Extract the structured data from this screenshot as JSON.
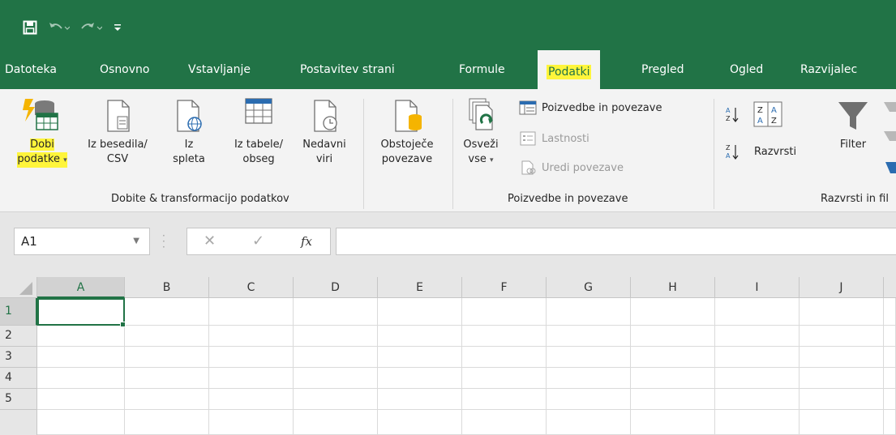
{
  "qat": {
    "save_icon": "save-icon",
    "undo_icon": "undo-icon",
    "redo_icon": "redo-icon",
    "customize_icon": "customize-qat-icon"
  },
  "tabs": [
    {
      "label": "Datoteka"
    },
    {
      "label": "Osnovno"
    },
    {
      "label": "Vstavljanje"
    },
    {
      "label": "Postavitev strani"
    },
    {
      "label": "Formule"
    },
    {
      "label": "Podatki",
      "active": true
    },
    {
      "label": "Pregled"
    },
    {
      "label": "Ogled"
    },
    {
      "label": "Razvijalec"
    }
  ],
  "ribbon": {
    "get_data": {
      "line1": "Dobi",
      "line2": "podatke"
    },
    "from_text": {
      "line1": "Iz besedila/",
      "line2": "CSV"
    },
    "from_web": {
      "line1": "Iz",
      "line2": "spleta"
    },
    "from_table": {
      "line1": "Iz tabele/",
      "line2": "obseg"
    },
    "recent": {
      "line1": "Nedavni",
      "line2": "viri"
    },
    "existing": {
      "line1": "Obstoječe",
      "line2": "povezave"
    },
    "group1_label": "Dobite & transformacijo podatkov",
    "refresh": {
      "line1": "Osveži",
      "line2": "vse"
    },
    "queries": "Poizvedbe in povezave",
    "properties": "Lastnosti",
    "edit_links": "Uredi povezave",
    "group2_label": "Poizvedbe in povezave",
    "sort": "Razvrsti",
    "filter": "Filter",
    "group3_label": "Razvrsti in fil"
  },
  "formula_bar": {
    "name_box": "A1",
    "fx_label": "fx",
    "value": ""
  },
  "grid": {
    "columns": [
      "A",
      "B",
      "C",
      "D",
      "E",
      "F",
      "G",
      "H",
      "I",
      "J"
    ],
    "rows": [
      "1",
      "2",
      "3",
      "4",
      "5"
    ],
    "selected_cell": "A1"
  },
  "colors": {
    "brand": "#217346",
    "highlight": "#fff53b"
  }
}
